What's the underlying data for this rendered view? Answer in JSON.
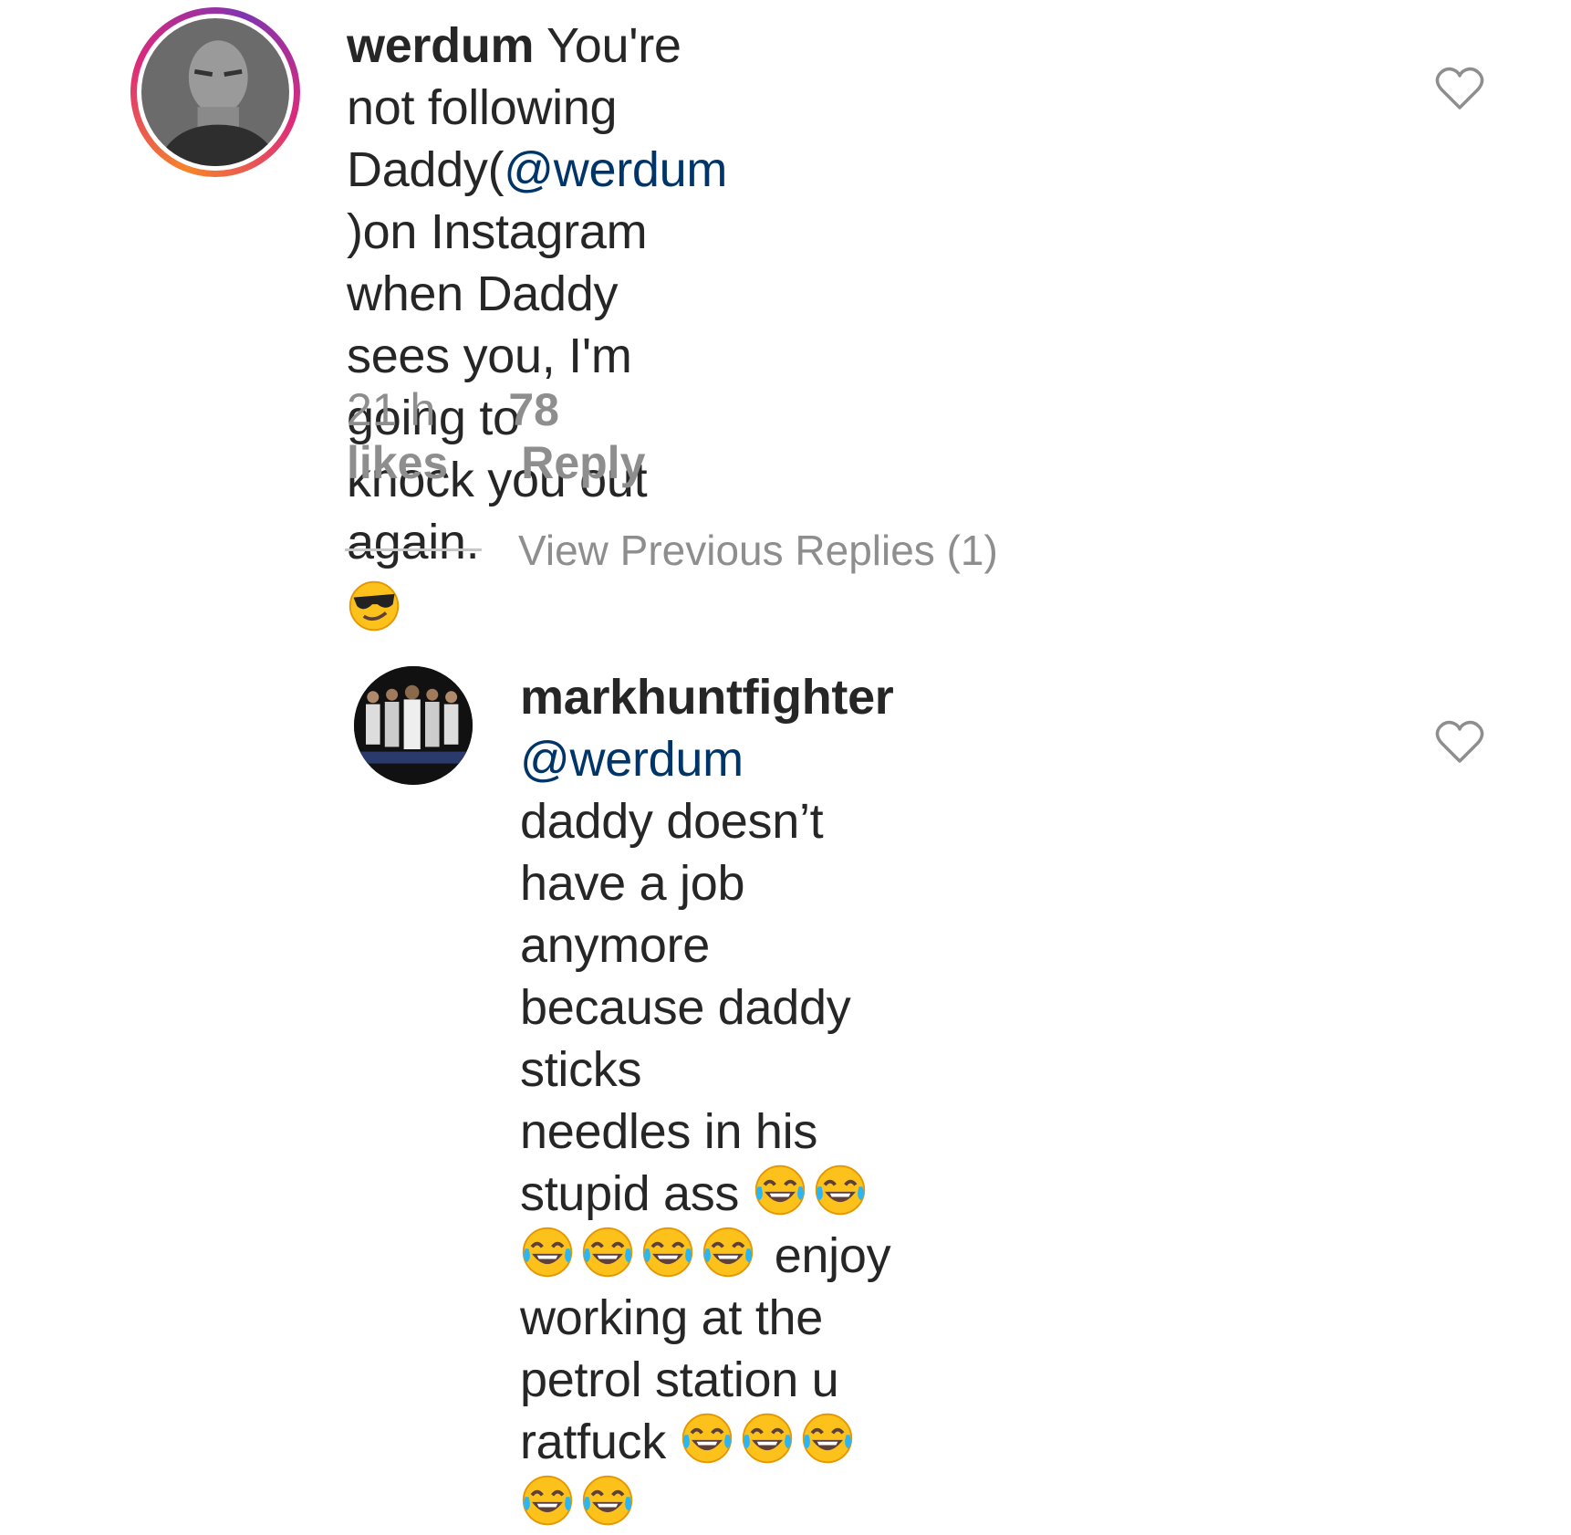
{
  "comment1": {
    "username": "werdum",
    "text_a": "You're not following",
    "text_b1": "Daddy(",
    "mention": "@werdum",
    "text_b2": " )on Instagram",
    "text_c": "when Daddy sees you, I'm going to",
    "text_d": "knock you out again.",
    "emoji": "smiling-face-with-sunglasses",
    "time": "21 h",
    "likes": "78 likes",
    "reply_label": "Reply"
  },
  "view_replies": "View Previous Replies (1)",
  "comment2": {
    "username": "markhuntfighter",
    "mention": "@werdum",
    "line_a": "daddy doesn’t have a job",
    "line_b": "anymore because daddy sticks",
    "line_c": "needles in his stupid ass",
    "line_d": "enjoy working at the",
    "line_e": "petrol station u ratfuck",
    "emoji": "face-with-tears-of-joy"
  },
  "colors": {
    "text": "#262626",
    "mention": "#003569",
    "meta": "#8e8e8e"
  }
}
